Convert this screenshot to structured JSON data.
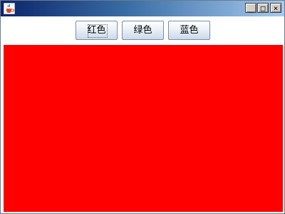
{
  "window": {
    "icon": "java-cup-icon",
    "controls": {
      "minimize": "_",
      "maximize": "□",
      "close": "×"
    }
  },
  "toolbar": {
    "buttons": [
      {
        "label": "红色",
        "focused": true
      },
      {
        "label": "绿色",
        "focused": false
      },
      {
        "label": "蓝色",
        "focused": false
      }
    ]
  },
  "panel": {
    "background_color": "#ff0000"
  },
  "colors": {
    "title_start": "#0b246a",
    "title_end": "#a6caf0"
  }
}
